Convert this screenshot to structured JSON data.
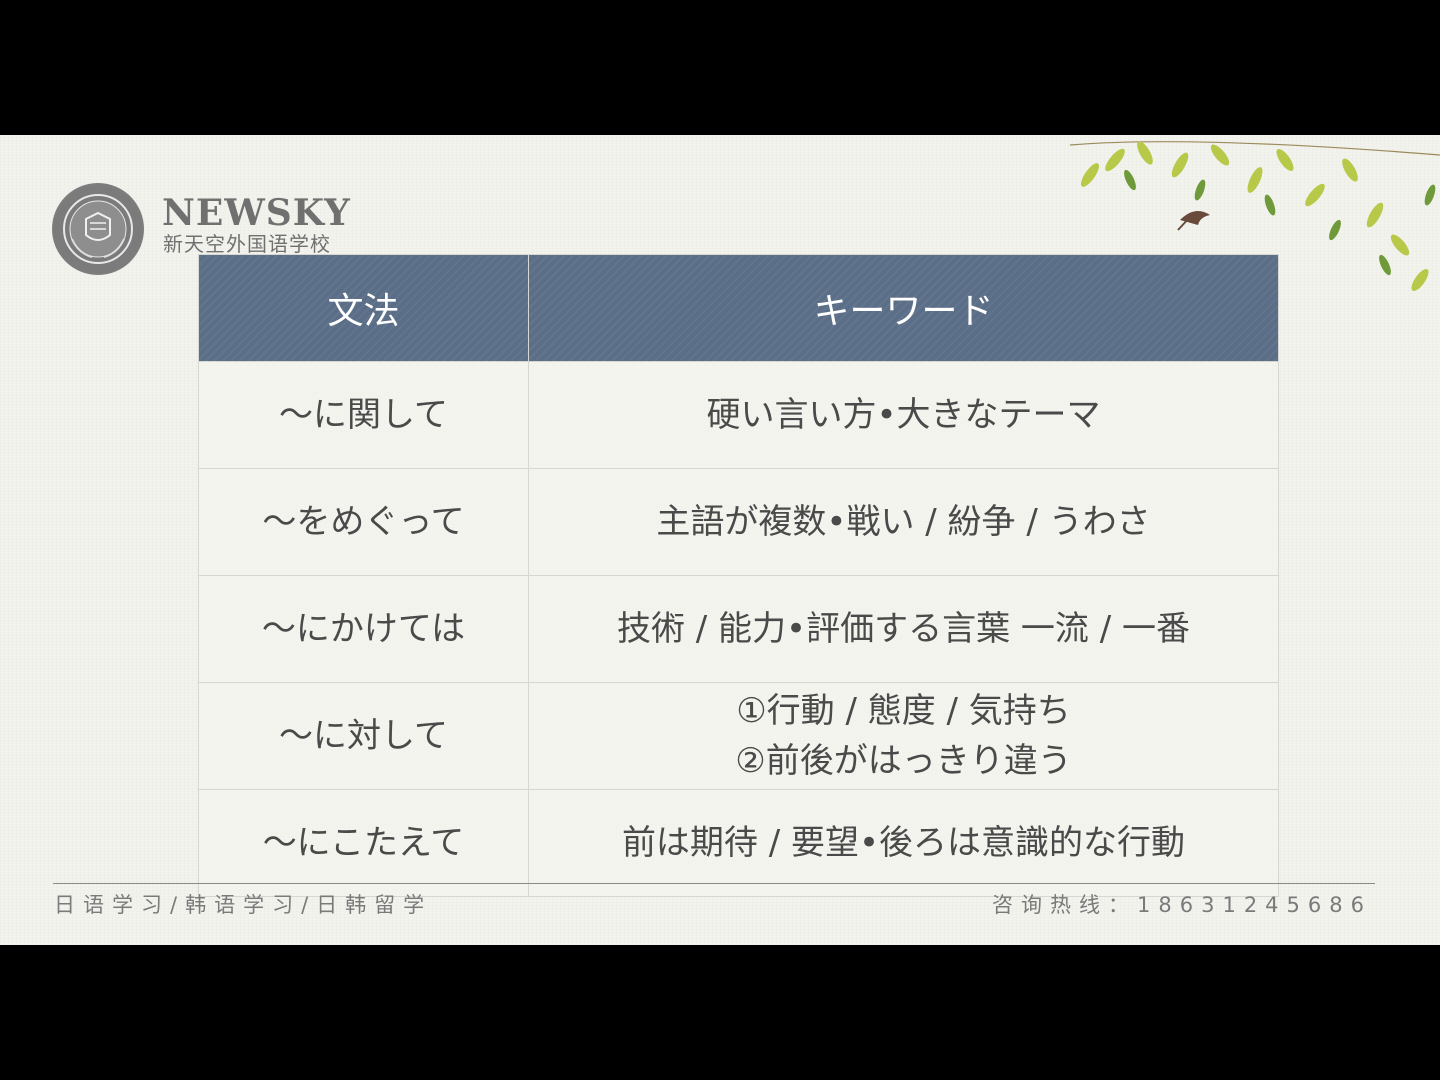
{
  "brand": {
    "name": "NEWSKY",
    "subtitle": "新天空外国语学校"
  },
  "table": {
    "headers": [
      "文法",
      "キーワード"
    ],
    "rows": [
      {
        "grammar": "～に関して",
        "keyword": [
          "硬い言い方•大きなテーマ"
        ]
      },
      {
        "grammar": "～をめぐって",
        "keyword": [
          "主語が複数•戦い / 紛争 / うわさ"
        ]
      },
      {
        "grammar": "～にかけては",
        "keyword": [
          "技術 / 能力•評価する言葉 一流 / 一番"
        ]
      },
      {
        "grammar": "～に対して",
        "keyword": [
          "①行動 / 態度 / 気持ち",
          "②前後がはっきり違う"
        ]
      },
      {
        "grammar": "～にこたえて",
        "keyword": [
          "前は期待 / 要望•後ろは意識的な行動"
        ]
      }
    ]
  },
  "footer": {
    "left": "日语学习/韩语学习/日韩留学",
    "contact_label": "咨询热线：",
    "phone": "18631245686"
  },
  "colors": {
    "header_bg": "#5b6e87",
    "slide_bg": "#f3f3ee",
    "text": "#4a4a4a"
  }
}
